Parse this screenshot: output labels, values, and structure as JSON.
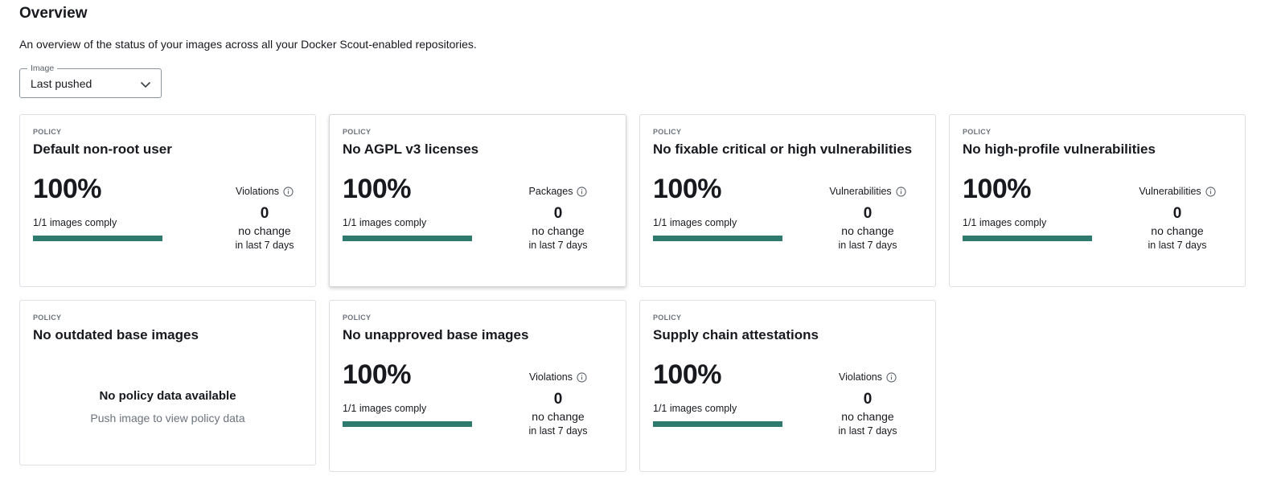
{
  "header": {
    "title": "Overview",
    "description": "An overview of the status of your images across all your Docker Scout-enabled repositories."
  },
  "image_select": {
    "label": "Image",
    "value": "Last pushed"
  },
  "colors": {
    "progress": "#2e7a6e",
    "track": "#e4e7ea"
  },
  "cards": [
    {
      "tag": "POLICY",
      "title": "Default non-root user",
      "percent": "100%",
      "comply": "1/1 images comply",
      "progress": 1.0,
      "metric_label": "Violations",
      "metric_value": "0",
      "change": "no change",
      "period": "in last 7 days"
    },
    {
      "tag": "POLICY",
      "title": "No AGPL v3 licenses",
      "percent": "100%",
      "comply": "1/1 images comply",
      "progress": 1.0,
      "metric_label": "Packages",
      "metric_value": "0",
      "change": "no change",
      "period": "in last 7 days"
    },
    {
      "tag": "POLICY",
      "title": "No fixable critical or high vulnerabilities",
      "percent": "100%",
      "comply": "1/1 images comply",
      "progress": 1.0,
      "metric_label": "Vulnerabilities",
      "metric_value": "0",
      "change": "no change",
      "period": "in last 7 days"
    },
    {
      "tag": "POLICY",
      "title": "No high-profile vulnerabilities",
      "percent": "100%",
      "comply": "1/1 images comply",
      "progress": 1.0,
      "metric_label": "Vulnerabilities",
      "metric_value": "0",
      "change": "no change",
      "period": "in last 7 days"
    },
    {
      "tag": "POLICY",
      "title": "No outdated base images",
      "empty_title": "No policy data available",
      "empty_sub": "Push image to view policy data"
    },
    {
      "tag": "POLICY",
      "title": "No unapproved base images",
      "percent": "100%",
      "comply": "1/1 images comply",
      "progress": 1.0,
      "metric_label": "Violations",
      "metric_value": "0",
      "change": "no change",
      "period": "in last 7 days"
    },
    {
      "tag": "POLICY",
      "title": "Supply chain attestations",
      "percent": "100%",
      "comply": "1/1 images comply",
      "progress": 1.0,
      "metric_label": "Violations",
      "metric_value": "0",
      "change": "no change",
      "period": "in last 7 days"
    }
  ]
}
